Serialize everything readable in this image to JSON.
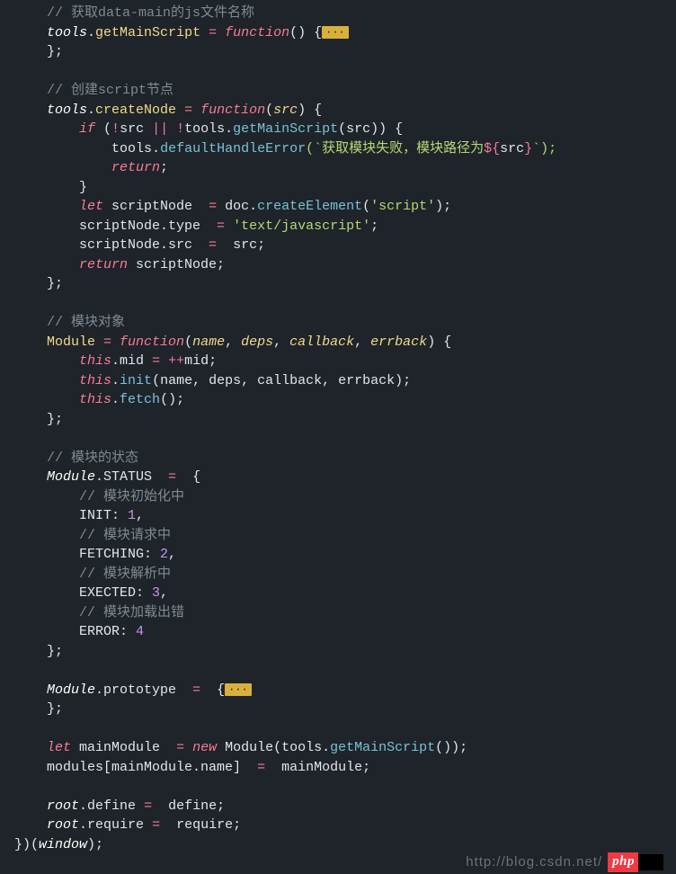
{
  "code": {
    "c1": "// 获取data-main的js文件名称",
    "tools": "tools",
    "dot": ".",
    "getMainScript": "getMainScript",
    "eq": " = ",
    "functionKw": "function",
    "parenEmpty": "() {",
    "fold1": "···",
    "closeBrace": "};",
    "c2": "// 创建script节点",
    "createNode": "createNode",
    "lparen": "(",
    "src": "src",
    "rparenBrace": ") {",
    "ifKw": "if",
    "cond_a": " (",
    "not": "!",
    "srcPlain": "src ",
    "or": "|| ",
    "condTail": "(src)) {",
    "defaultHandleError": "defaultHandleError",
    "backtick_open": "(`",
    "s_errMsg": "获取模块失败，模块路径为",
    "interp_open": "${",
    "src2": "src",
    "interp_close": "}",
    "backtick_close": "`);",
    "returnKw": "return",
    "semi": ";",
    "rbrace": "}",
    "letKw": "let",
    "scriptNode": " scriptNode ",
    "doc": "doc.",
    "createElement": "createElement",
    "s_script": "'script'",
    "rpsemi": ");",
    "scriptNodeType": "scriptNode.type ",
    "s_textJs": "'text/javascript'",
    "scriptNodeSrc": "scriptNode.src ",
    "srcSemi": " src;",
    "retScript": " scriptNode;",
    "c3": "// 模块对象",
    "Module": "Module",
    "name": "name",
    "comma": ", ",
    "deps": "deps",
    "callback": "callback",
    "errback": "errback",
    "thisKw": "this",
    "mid": "mid",
    "midPlain": "mid;",
    "incr": "++",
    "init": "init",
    "argsInit": "(name, deps, callback, errback);",
    "fetch": "fetch",
    "callEmpty": "();",
    "c4": "// 模块的状态",
    "STATUS": ".STATUS ",
    "lbrace": " {",
    "c5": "// 模块初始化中",
    "INIT": "INIT: ",
    "n1": "1",
    "commaOnly": ",",
    "c6": "// 模块请求中",
    "FETCHING": "FETCHING: ",
    "n2": "2",
    "c7": "// 模块解析中",
    "EXECTED": "EXECTED: ",
    "n3": "3",
    "c8": "// 模块加载出错",
    "ERROR": "ERROR: ",
    "n4": "4",
    "prototype": ".prototype ",
    "eqBrace": " {",
    "mainModule": " mainModule ",
    "newKw": "new",
    "ModuleCall": " Module(tools.",
    "closeCall": "());",
    "modulesLine": "modules[mainModule.name] ",
    "mainModuleSemi": " mainModule;",
    "root": "root",
    "define": "define",
    "definePlain": " define;",
    "require": "require",
    "requirePlain": " require;",
    "iifeClose": "})(",
    "window": "window",
    "iifeEnd": ");"
  },
  "watermark": {
    "url": "http://blog.csdn.net/",
    "badge": "php"
  },
  "chart_data": null
}
